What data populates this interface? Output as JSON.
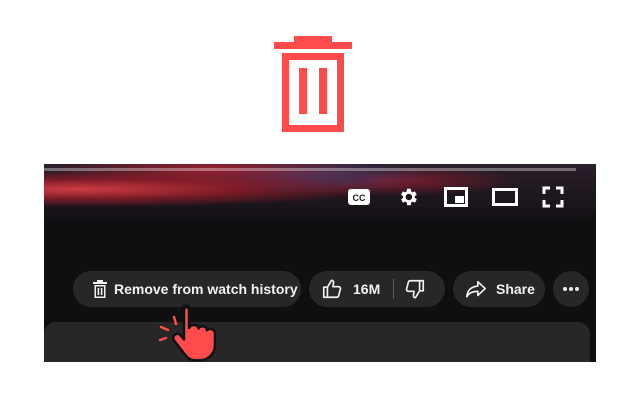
{
  "hero": {
    "icon": "trash-icon",
    "color": "#ff4b4b"
  },
  "player": {
    "controls": [
      {
        "name": "captions-icon",
        "label": "CC"
      },
      {
        "name": "settings-icon"
      },
      {
        "name": "miniplayer-icon"
      },
      {
        "name": "theater-mode-icon"
      },
      {
        "name": "fullscreen-icon"
      }
    ]
  },
  "actions": {
    "remove_label": "Remove from watch history",
    "like_count": "16M",
    "share_label": "Share"
  },
  "colors": {
    "accent": "#ff4b4b",
    "surface": "#0f0f0f",
    "pill": "#272727",
    "text": "#f1f1f1"
  }
}
